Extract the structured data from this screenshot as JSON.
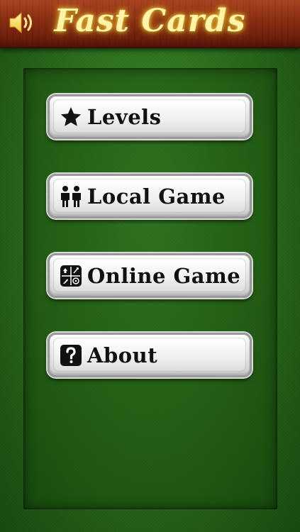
{
  "header": {
    "title": "Fast Cards",
    "sound_icon": "speaker-volume-icon"
  },
  "menu": {
    "items": [
      {
        "label": "Levels",
        "icon": "star-icon"
      },
      {
        "label": "Local Game",
        "icon": "two-players-icon"
      },
      {
        "label": "Online Game",
        "icon": "online-game-grid-icon"
      },
      {
        "label": "About",
        "icon": "question-mark-icon"
      }
    ]
  },
  "colors": {
    "felt_green": "#2c6e1d",
    "wood_red": "#8b2f14",
    "title_gold": "#fff3a8",
    "button_face": "#f1f1f1"
  }
}
